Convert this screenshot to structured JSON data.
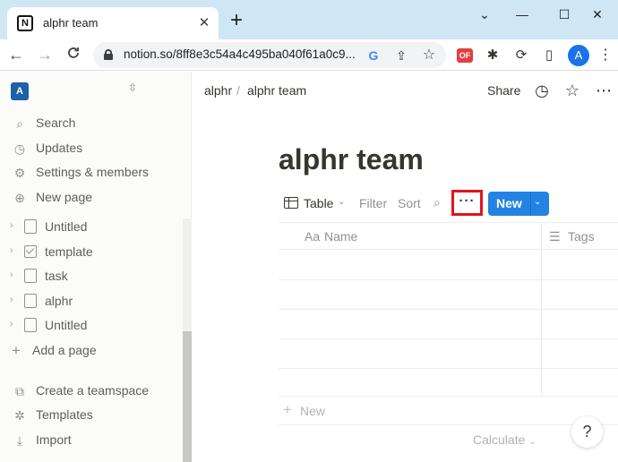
{
  "browser": {
    "tab_title": "alphr team",
    "tab_favicon": "N",
    "tab_close": "✕",
    "new_tab": "+",
    "window_controls": {
      "collapse": "⌄",
      "minimize": "—",
      "maximize": "☐",
      "close": "✕"
    },
    "nav": {
      "back": "←",
      "forward": "→",
      "reload": "C"
    },
    "url": "notion.so/8ff8e3c54a4c495ba040f61a0c9...",
    "omnibox_icons": {
      "google": "G",
      "share": "⇪",
      "bookmark": "☆"
    },
    "extensions": {
      "of_badge": "OF",
      "puzzle": "✱",
      "sync": "⟳",
      "sidepanel": "▯"
    },
    "profile_initial": "A",
    "menu": "⋮",
    "accent_color": "#1a73e8"
  },
  "sidebar": {
    "workspace_initial": "A",
    "workspace_switch": "⇳",
    "menu_items": [
      {
        "label": "Search",
        "icon": "search-icon"
      },
      {
        "label": "Updates",
        "icon": "clock-icon"
      },
      {
        "label": "Settings & members",
        "icon": "gear-icon"
      },
      {
        "label": "New page",
        "icon": "plus-circle-icon"
      }
    ],
    "pages": [
      {
        "label": "Untitled",
        "icon": "page-icon"
      },
      {
        "label": "template",
        "icon": "checkbox-icon"
      },
      {
        "label": "task",
        "icon": "task-page-icon"
      },
      {
        "label": "alphr",
        "icon": "page-icon"
      },
      {
        "label": "Untitled",
        "icon": "page-icon"
      }
    ],
    "add_page": "Add a page",
    "footer_items": [
      {
        "label": "Create a teamspace",
        "icon": "teamspace-icon"
      },
      {
        "label": "Templates",
        "icon": "templates-icon"
      },
      {
        "label": "Import",
        "icon": "import-icon"
      }
    ]
  },
  "topbar": {
    "breadcrumbs": [
      "alphr",
      "alphr team"
    ],
    "breadcrumb_separator": "/",
    "share": "Share",
    "history_icon": "◷",
    "favorite_icon": "☆",
    "more_icon": "⋯"
  },
  "page": {
    "title": "alphr team",
    "view": {
      "label": "Table",
      "chevron": "⌄"
    },
    "filter": "Filter",
    "sort": "Sort",
    "search_icon": "⌕",
    "more": "···",
    "new_button": "New",
    "new_button_chevron": "⌄",
    "new_button_color": "#2383e2",
    "highlight_color": "#e3141d",
    "columns": [
      {
        "prefix": "Aa",
        "label": "Name"
      },
      {
        "prefix": "☰",
        "label": "Tags"
      }
    ],
    "row_count": 5,
    "add_row": "New",
    "calculate": "Calculate",
    "calculate_chevron": "⌄",
    "help": "?"
  }
}
